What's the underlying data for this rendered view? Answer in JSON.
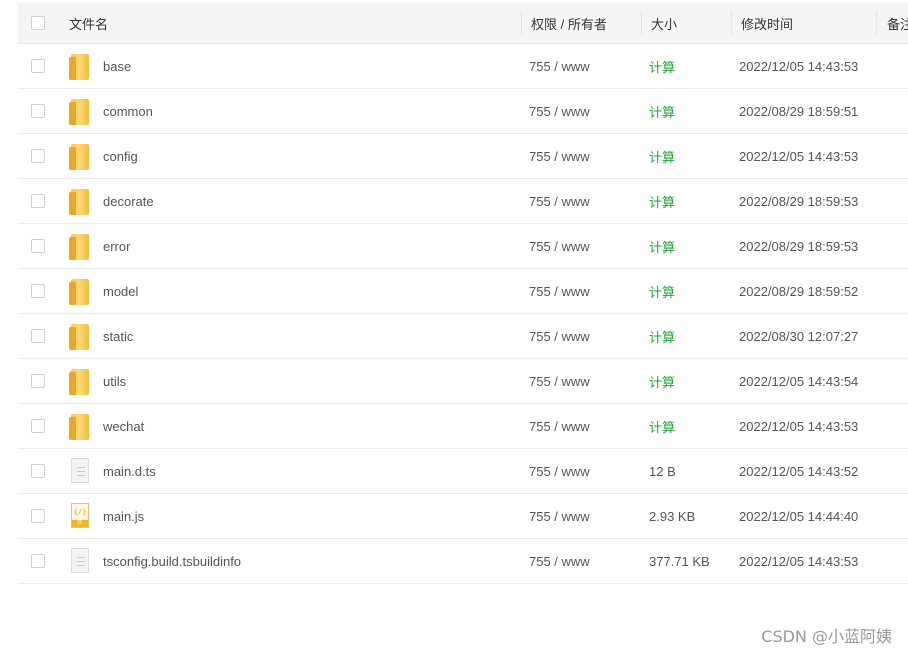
{
  "header": {
    "name": "文件名",
    "permission": "权限 / 所有者",
    "size": "大小",
    "modified": "修改时间",
    "note": "备注"
  },
  "rows": [
    {
      "name": "base",
      "type": "folder",
      "permission": "755 / www",
      "size": "计算",
      "modified": "2022/12/05 14:43:53"
    },
    {
      "name": "common",
      "type": "folder",
      "permission": "755 / www",
      "size": "计算",
      "modified": "2022/08/29 18:59:51"
    },
    {
      "name": "config",
      "type": "folder",
      "permission": "755 / www",
      "size": "计算",
      "modified": "2022/12/05 14:43:53"
    },
    {
      "name": "decorate",
      "type": "folder",
      "permission": "755 / www",
      "size": "计算",
      "modified": "2022/08/29 18:59:53"
    },
    {
      "name": "error",
      "type": "folder",
      "permission": "755 / www",
      "size": "计算",
      "modified": "2022/08/29 18:59:53"
    },
    {
      "name": "model",
      "type": "folder",
      "permission": "755 / www",
      "size": "计算",
      "modified": "2022/08/29 18:59:52"
    },
    {
      "name": "static",
      "type": "folder",
      "permission": "755 / www",
      "size": "计算",
      "modified": "2022/08/30 12:07:27"
    },
    {
      "name": "utils",
      "type": "folder",
      "permission": "755 / www",
      "size": "计算",
      "modified": "2022/12/05 14:43:54"
    },
    {
      "name": "wechat",
      "type": "folder",
      "permission": "755 / www",
      "size": "计算",
      "modified": "2022/12/05 14:43:53"
    },
    {
      "name": "main.d.ts",
      "type": "file",
      "permission": "755 / www",
      "size": "12 B",
      "modified": "2022/12/05 14:43:52"
    },
    {
      "name": "main.js",
      "type": "js",
      "permission": "755 / www",
      "size": "2.93 KB",
      "modified": "2022/12/05 14:44:40"
    },
    {
      "name": "tsconfig.build.tsbuildinfo",
      "type": "file",
      "permission": "755 / www",
      "size": "377.71 KB",
      "modified": "2022/12/05 14:43:53"
    }
  ],
  "icons": {
    "folder": "folder-icon",
    "file": "file-icon",
    "js": "js-file-icon",
    "js_top": "{/}",
    "js_tag": "JS"
  },
  "colors": {
    "calc_link": "#20a53a",
    "header_bg": "#f5f5f5",
    "folder": "#f7c84d"
  },
  "watermark": "CSDN @小蓝阿姨"
}
